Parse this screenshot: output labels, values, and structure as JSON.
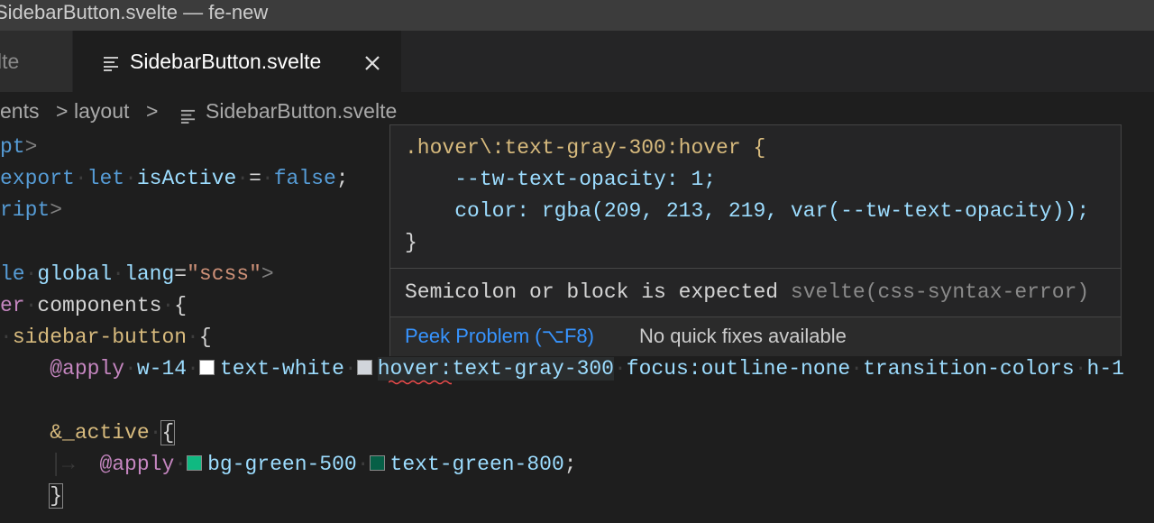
{
  "window": {
    "title": "SidebarButton.svelte — fe-new"
  },
  "tabs": [
    {
      "label": "lte",
      "active": false
    },
    {
      "label": "SidebarButton.svelte",
      "active": true,
      "close_icon": "close-icon"
    }
  ],
  "breadcrumb": {
    "items": [
      "ents",
      "layout",
      "SidebarButton.svelte"
    ],
    "separator": ">"
  },
  "editor": {
    "lines": [
      {
        "parts": [
          "pt",
          ">"
        ]
      },
      {
        "parts": [
          "export",
          "let",
          "isActive",
          "=",
          "false",
          ";"
        ]
      },
      {
        "parts": [
          "ript",
          ">"
        ]
      },
      {
        "parts": []
      },
      {
        "parts": [
          "le",
          "global",
          "lang",
          "=",
          "\"scss\"",
          ">"
        ]
      },
      {
        "parts": [
          "er",
          "components",
          "{"
        ]
      },
      {
        "parts": [
          "sidebar-button",
          "{"
        ]
      },
      {
        "parts": [
          "@apply",
          "w-14",
          "text-white",
          "hover:text-gray-300",
          "focus:outline-none",
          "transition-colors",
          "h-1"
        ]
      },
      {
        "parts": []
      },
      {
        "parts": [
          "&_active",
          "{"
        ]
      },
      {
        "parts": [
          "@apply",
          "bg-green-500",
          "text-green-800",
          ";"
        ]
      },
      {
        "parts": [
          "}"
        ]
      }
    ],
    "swatch_colors": {
      "text_white": "#ffffff",
      "hover_gray": "#d1d5db",
      "bg_green": "#10b981",
      "text_green": "#065f46"
    }
  },
  "hover_widget": {
    "code_lines": [
      ".hover\\:text-gray-300:hover {",
      "    --tw-text-opacity: 1;",
      "    color: rgba(209, 213, 219, var(--tw-text-opacity));",
      "}"
    ],
    "diagnostic": {
      "message": "Semicolon or block is expected",
      "source": "svelte(css-syntax-error)"
    },
    "actions": {
      "peek": "Peek Problem (⌥F8)",
      "no_fix": "No quick fixes available"
    }
  },
  "colors": {
    "editor_bg": "#1e1e1e",
    "link": "#3794ff",
    "error_squiggle": "#f14c4c"
  }
}
